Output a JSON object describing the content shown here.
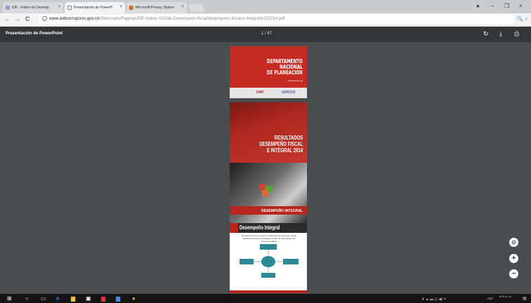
{
  "tabs": [
    {
      "label": "IDF - Indice de Desemp",
      "close": "×",
      "icon": "page-icon"
    },
    {
      "label": "Presentación de PowerP",
      "close": "×",
      "icon": "document-icon"
    },
    {
      "label": "Microsoft Privacy Statem",
      "close": "×",
      "icon": "microsoft-icon"
    }
  ],
  "window": {
    "user_icon": "user-icon",
    "minimize": "–",
    "restore": "❐",
    "close": "×"
  },
  "address": {
    "domain": "www.anticorrupcion.gov.co",
    "path": "/SiteAssets/Paginas/IDF-Indice-%20de-Desempeno-fiscal/desempeno-fiscal-e-integral%202014.pdf",
    "back": "←",
    "forward": "→",
    "reload": "C"
  },
  "viewer": {
    "title": "Presentación de PowerPoint",
    "page": "1",
    "total": "/ 47",
    "rotate": "↻",
    "download": "⤓",
    "print": "⎙"
  },
  "slides": {
    "s1": {
      "title": [
        "DEPARTAMENTO",
        "NACIONAL",
        "DE PLANEACIÓN"
      ],
      "sub": "www.dnp.gov.co",
      "logo_left": "DNP",
      "logo_right": "GOV.CO"
    },
    "s2": {
      "title": [
        "RESULTADOS",
        "DESEMPEÑO FISCAL",
        "E INTEGRAL 2014"
      ]
    },
    "s3": {
      "title": "DESEMPEÑO INTEGRAL"
    },
    "s4": {
      "title": "Desempeño Integral",
      "desc": "Herramienta que permite la evaluación de la gestión de las administraciones municipales a partir de información de insumo-producto"
    }
  },
  "zoom": {
    "fit": "⊙",
    "in": "+",
    "out": "−"
  },
  "taskbar": {
    "clock": "6:42 p. m.",
    "date": "",
    "lang": "ESP"
  },
  "colors": {
    "brand_red": "#c52b23",
    "teal": "#2a8a95",
    "viewer_bg": "#4a4d50",
    "toolbar": "#323639"
  }
}
